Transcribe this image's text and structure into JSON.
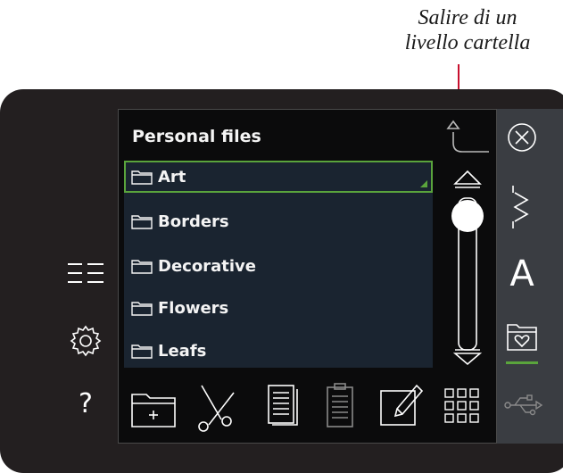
{
  "annotation": {
    "line1": "Salire di un",
    "line2": "livello cartella"
  },
  "panel": {
    "title": "Personal files"
  },
  "files": [
    {
      "label": "Art",
      "selected": true
    },
    {
      "label": "Borders",
      "selected": false
    },
    {
      "label": "Decorative",
      "selected": false
    },
    {
      "label": "Flowers",
      "selected": false
    },
    {
      "label": "Leafs",
      "selected": false
    }
  ],
  "icons": {
    "left": [
      "list-view-icon",
      "settings-icon",
      "help-icon"
    ],
    "toolbar": [
      "new-folder-icon",
      "cut-icon",
      "copy-icon",
      "paste-icon",
      "rename-icon",
      "grid-view-icon"
    ],
    "right_rail": [
      "close-icon",
      "stitch-icon",
      "font-icon",
      "personal-folder-icon",
      "usb-icon"
    ],
    "help_glyph": "?",
    "font_glyph": "A"
  },
  "colors": {
    "accent": "#5aa43c",
    "callout": "#c8102e",
    "list_bg": "#1a2430",
    "panel_bg": "#0b0b0c",
    "rail_bg": "#3a3d42"
  }
}
